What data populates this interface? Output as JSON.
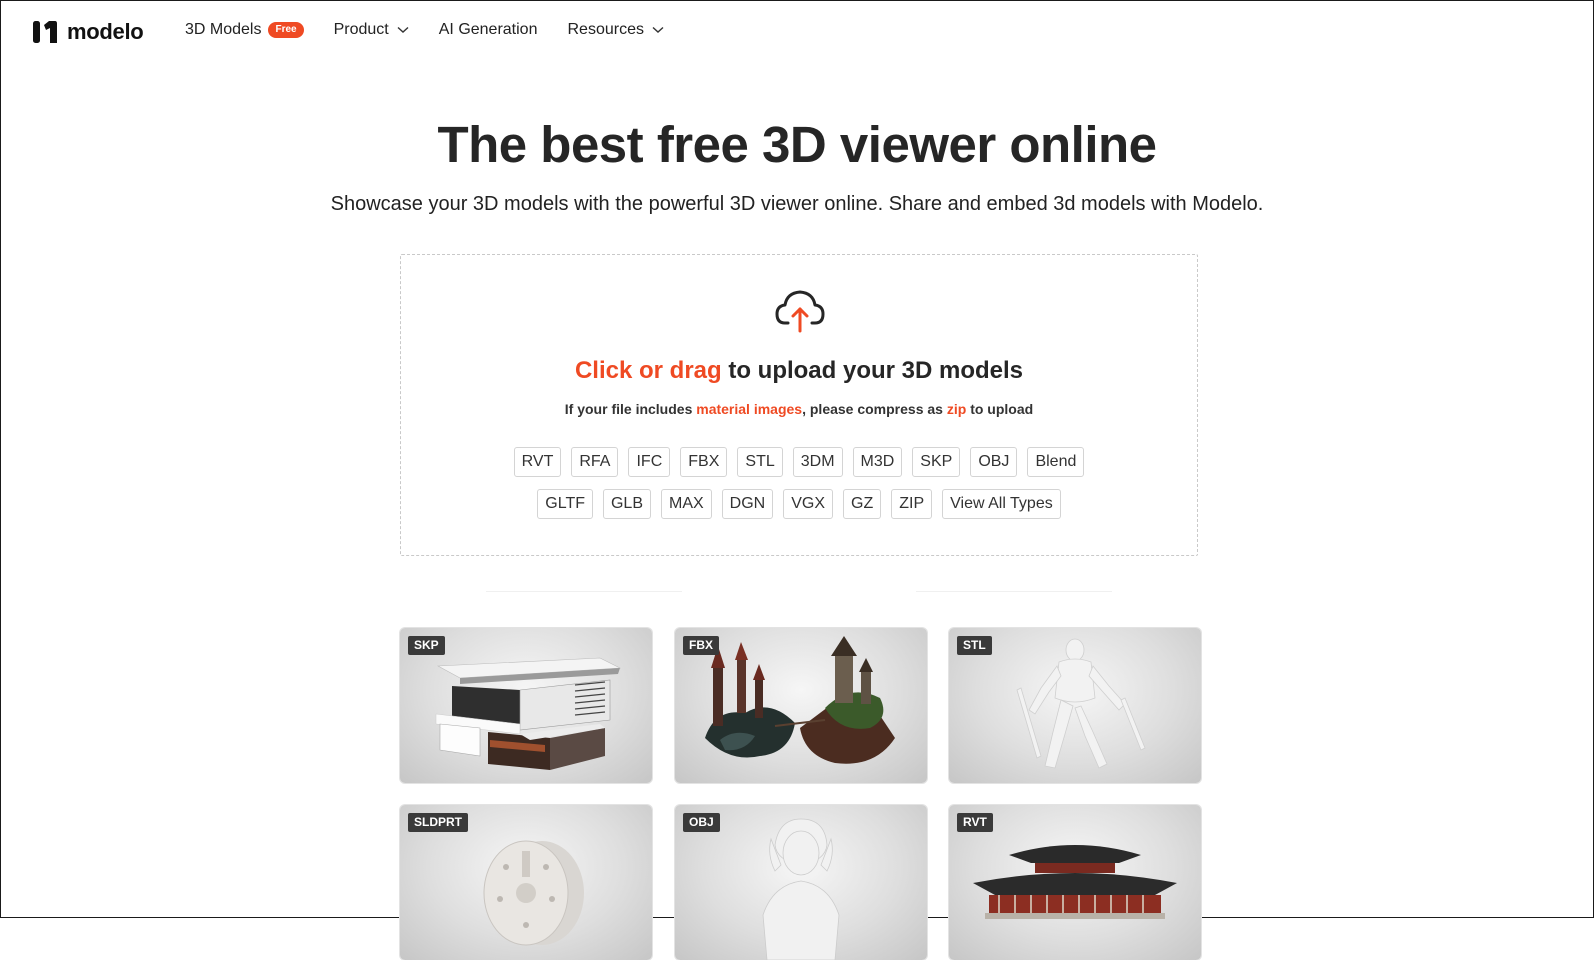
{
  "brand": {
    "name": "modelo"
  },
  "nav": {
    "items": [
      {
        "label": "3D Models",
        "badge": "Free"
      },
      {
        "label": "Product",
        "dropdown": true
      },
      {
        "label": "AI Generation"
      },
      {
        "label": "Resources",
        "dropdown": true
      }
    ]
  },
  "hero": {
    "title": "The best free 3D viewer online",
    "subtitle": "Showcase your 3D models with the powerful 3D viewer online. Share and embed 3d models with Modelo."
  },
  "upload": {
    "headline_accent": "Click or drag",
    "headline_rest": " to upload your 3D models",
    "note_1": "If your file includes ",
    "note_accent_1": "material images",
    "note_2": ", please compress as ",
    "note_accent_2": "zip",
    "note_3": " to upload",
    "types_row1": [
      "RVT",
      "RFA",
      "IFC",
      "FBX",
      "STL",
      "3DM",
      "M3D",
      "SKP",
      "OBJ",
      "Blend"
    ],
    "types_row2": [
      "GLTF",
      "GLB",
      "MAX",
      "DGN",
      "VGX",
      "GZ",
      "ZIP",
      "View All Types"
    ]
  },
  "gallery": {
    "cards": [
      {
        "format": "SKP",
        "subject": "modern house"
      },
      {
        "format": "FBX",
        "subject": "fantasy castle island"
      },
      {
        "format": "STL",
        "subject": "armored robot figure"
      },
      {
        "format": "SLDPRT",
        "subject": "lathe chuck part"
      },
      {
        "format": "OBJ",
        "subject": "character bust"
      },
      {
        "format": "RVT",
        "subject": "chinese temple"
      }
    ]
  },
  "colors": {
    "accent": "#ef4a23",
    "text": "#262626",
    "badge_bg": "#3a3a3a"
  }
}
